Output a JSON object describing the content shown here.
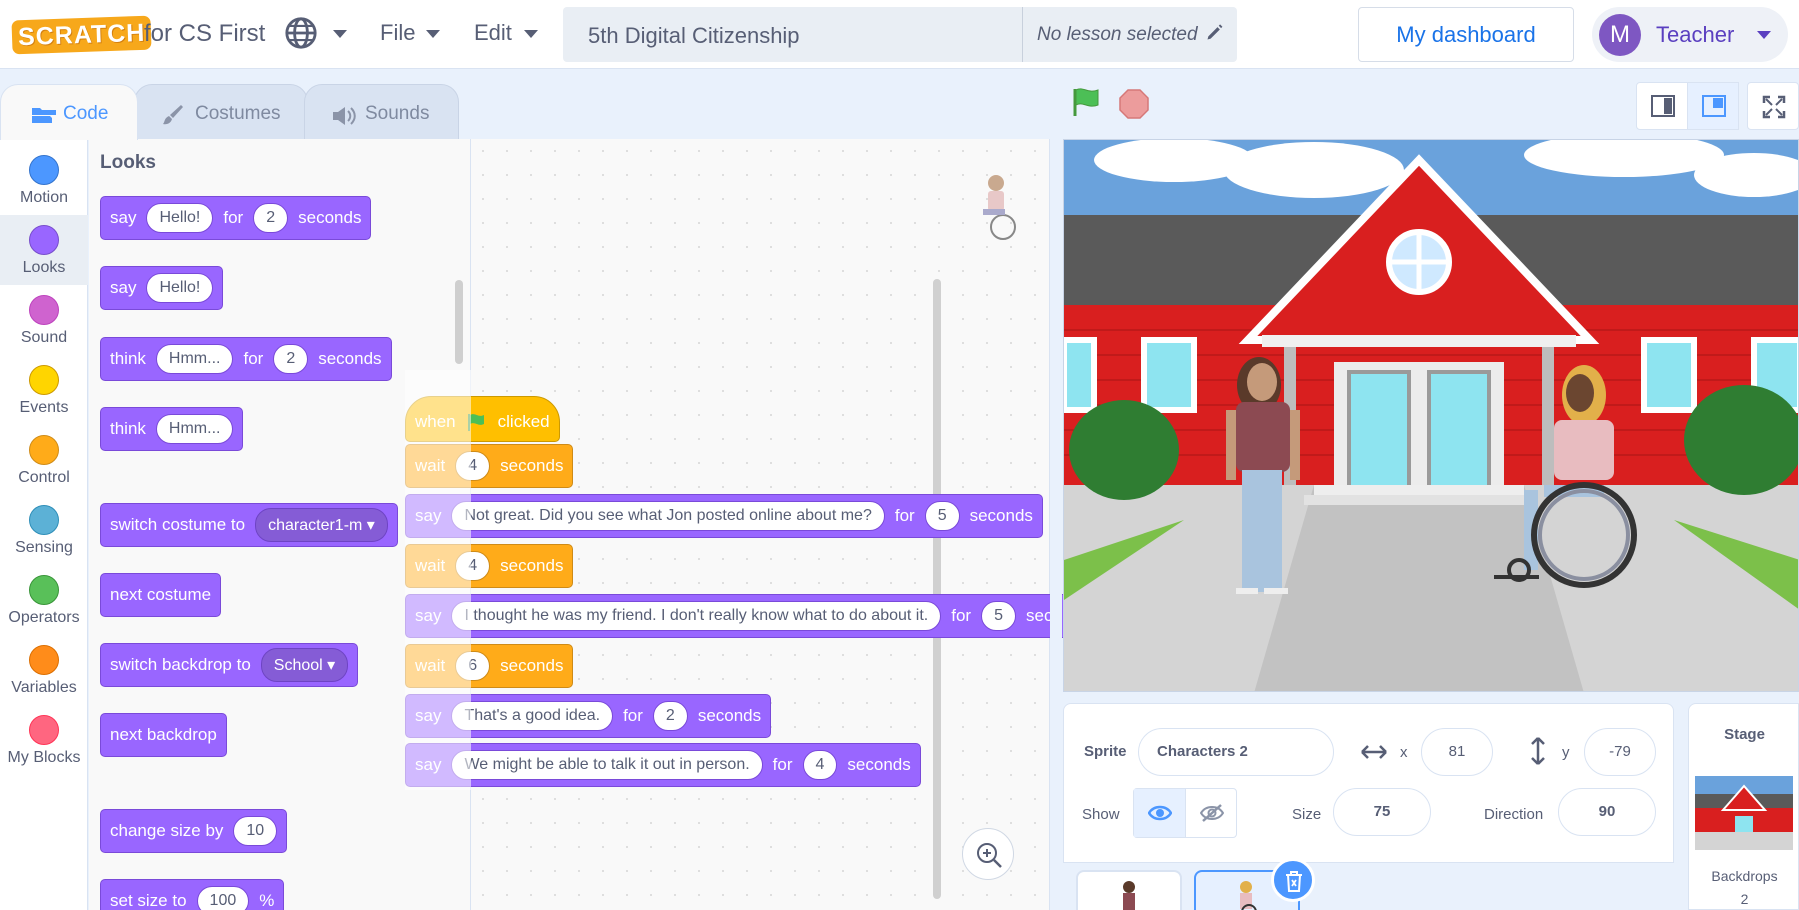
{
  "header": {
    "logo_text": "SCRATCH",
    "brand": "for CS First",
    "menus": {
      "file": "File",
      "edit": "Edit"
    },
    "project_title": "5th Digital Citizenship",
    "lesson": "No lesson selected",
    "dashboard": "My dashboard",
    "user_initial": "M",
    "user_name": "Teacher"
  },
  "tabs": {
    "code": "Code",
    "costumes": "Costumes",
    "sounds": "Sounds"
  },
  "categories": [
    {
      "label": "Motion",
      "color": "#4c97ff"
    },
    {
      "label": "Looks",
      "color": "#9966ff"
    },
    {
      "label": "Sound",
      "color": "#cf63cf"
    },
    {
      "label": "Events",
      "color": "#ffd500"
    },
    {
      "label": "Control",
      "color": "#ffab19"
    },
    {
      "label": "Sensing",
      "color": "#5cb1d6"
    },
    {
      "label": "Operators",
      "color": "#59c059"
    },
    {
      "label": "Variables",
      "color": "#ff8c1a"
    },
    {
      "label": "My Blocks",
      "color": "#ff6680"
    }
  ],
  "palette": {
    "title": "Looks",
    "say_for": {
      "say": "say",
      "msg": "Hello!",
      "for": "for",
      "secs": "2",
      "unit": "seconds"
    },
    "say": {
      "say": "say",
      "msg": "Hello!"
    },
    "think_for": {
      "think": "think",
      "msg": "Hmm...",
      "for": "for",
      "secs": "2",
      "unit": "seconds"
    },
    "think": {
      "think": "think",
      "msg": "Hmm..."
    },
    "switch_costume": {
      "label": "switch costume to",
      "value": "character1-m"
    },
    "next_costume": "next costume",
    "switch_backdrop": {
      "label": "switch backdrop to",
      "value": "School"
    },
    "next_backdrop": "next backdrop",
    "change_size": {
      "label": "change size by",
      "value": "10"
    },
    "set_size": {
      "label": "set size to",
      "value": "100",
      "unit": "%"
    }
  },
  "script": {
    "hat": {
      "when": "when",
      "clicked": "clicked"
    },
    "blocks": [
      {
        "type": "wait",
        "w": "wait",
        "v": "4",
        "u": "seconds"
      },
      {
        "type": "say",
        "s": "say",
        "msg": "Not great.  Did you see what Jon posted online about me?",
        "f": "for",
        "v": "5",
        "u": "seconds"
      },
      {
        "type": "wait",
        "w": "wait",
        "v": "4",
        "u": "seconds"
      },
      {
        "type": "say",
        "s": "say",
        "msg": "I thought he was my friend.  I don't really know what to do about it.",
        "f": "for",
        "v": "5",
        "u": "seconds"
      },
      {
        "type": "wait",
        "w": "wait",
        "v": "6",
        "u": "seconds"
      },
      {
        "type": "say",
        "s": "say",
        "msg": "That's a good idea.",
        "f": "for",
        "v": "2",
        "u": "seconds"
      },
      {
        "type": "say",
        "s": "say",
        "msg": "We might be able to talk it out in person.",
        "f": "for",
        "v": "4",
        "u": "seconds"
      }
    ]
  },
  "sprite_info": {
    "sprite_label": "Sprite",
    "sprite_name": "Characters 2",
    "x_label": "x",
    "x": "81",
    "y_label": "y",
    "y": "-79",
    "show_label": "Show",
    "size_label": "Size",
    "size": "75",
    "direction_label": "Direction",
    "direction": "90"
  },
  "stage_pane": {
    "title": "Stage",
    "backdrops_label": "Backdrops",
    "backdrops_count": "2"
  }
}
